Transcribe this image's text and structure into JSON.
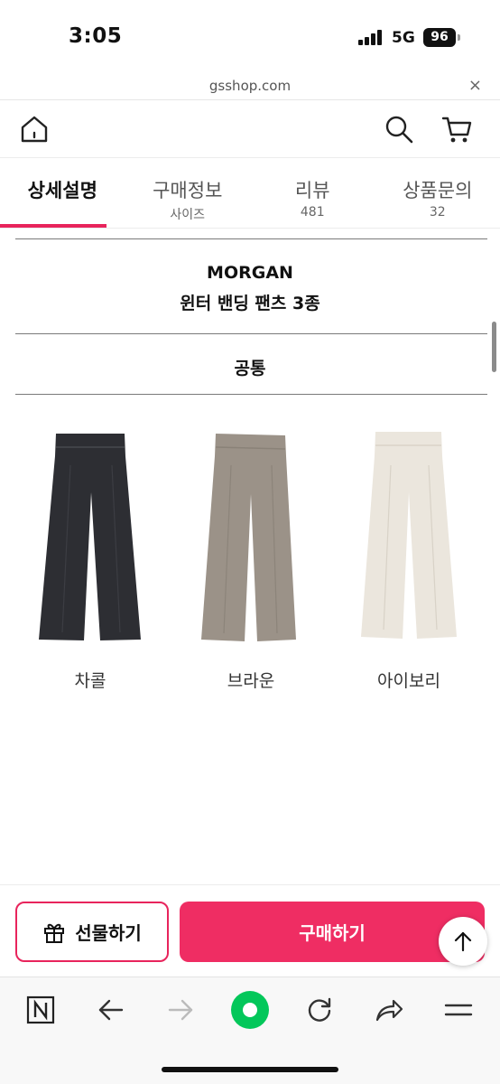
{
  "status": {
    "time": "3:05",
    "network": "5G",
    "battery": "96"
  },
  "browser": {
    "url": "gsshop.com",
    "close_symbol": "×"
  },
  "tabs": [
    {
      "label": "상세설명",
      "sub": ""
    },
    {
      "label": "구매정보",
      "sub": "사이즈"
    },
    {
      "label": "리뷰",
      "sub": "481"
    },
    {
      "label": "상품문의",
      "sub": "32"
    }
  ],
  "product": {
    "brand": "MORGAN",
    "name": "윈터 밴딩 팬츠 3종"
  },
  "section": {
    "title": "공통"
  },
  "colors": [
    {
      "label": "차콜",
      "swatch": "#2d2e33"
    },
    {
      "label": "브라운",
      "swatch": "#9b9288"
    },
    {
      "label": "아이보리",
      "swatch": "#ebe6dd"
    }
  ],
  "actions": {
    "gift_label": "선물하기",
    "buy_label": "구매하기"
  },
  "theme": {
    "accent": "#e8245c",
    "buy_bg": "#ef2d63",
    "naver_green": "#03c75a"
  },
  "icons": {
    "top_nav": [
      "home-icon",
      "search-icon",
      "cart-icon"
    ],
    "toolbar": [
      "naver-n-icon",
      "back-arrow-icon",
      "forward-arrow-icon",
      "green-dot-icon",
      "refresh-icon",
      "share-icon",
      "menu-icon"
    ]
  }
}
